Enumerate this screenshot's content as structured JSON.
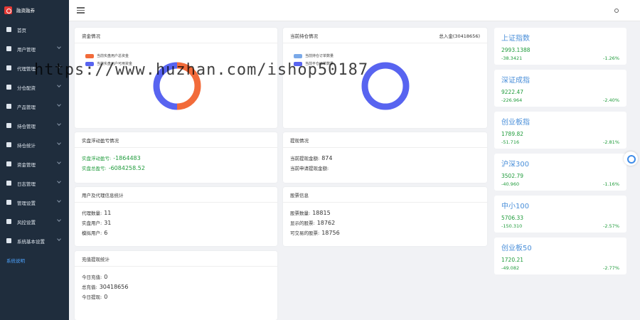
{
  "brand": {
    "title": "融资融券"
  },
  "sidebar": {
    "items": [
      {
        "label": "首页",
        "icon": "home-icon",
        "has_chevron": false
      },
      {
        "label": "用户管理",
        "icon": "user-icon",
        "has_chevron": true
      },
      {
        "label": "代理管理",
        "icon": "agent-icon",
        "has_chevron": true
      },
      {
        "label": "分仓配资",
        "icon": "split-icon",
        "has_chevron": true
      },
      {
        "label": "产品管理",
        "icon": "product-icon",
        "has_chevron": true
      },
      {
        "label": "持仓管理",
        "icon": "position-icon",
        "has_chevron": true
      },
      {
        "label": "持仓统计",
        "icon": "stats-icon",
        "has_chevron": true
      },
      {
        "label": "资金管理",
        "icon": "wallet-icon",
        "has_chevron": true
      },
      {
        "label": "日志管理",
        "icon": "log-icon",
        "has_chevron": true
      },
      {
        "label": "管理设置",
        "icon": "admin-icon",
        "has_chevron": true
      },
      {
        "label": "风控设置",
        "icon": "shield-icon",
        "has_chevron": true
      },
      {
        "label": "系统基本设置",
        "icon": "settings-icon",
        "has_chevron": true
      },
      {
        "label": "系统说明",
        "icon": "",
        "has_chevron": false,
        "active": true
      }
    ]
  },
  "funds": {
    "title": "资金情况",
    "legend": [
      {
        "label": "当前实盘用户总资金",
        "color": "#f26b3a"
      },
      {
        "label": "当前实盘用户可用资金",
        "color": "#5864f0"
      }
    ],
    "chart": {
      "type": "pie",
      "values": [
        50,
        50
      ],
      "colors": [
        "#f26b3a",
        "#5864f0"
      ]
    }
  },
  "positions": {
    "title": "当前持仓情况",
    "total_label": "总入金(30418656)",
    "legend": [
      {
        "label": "当前持仓订单数量",
        "color": "#7aa9e8"
      },
      {
        "label": "当前平仓订单数量",
        "color": "#5864f0"
      }
    ],
    "chart": {
      "type": "pie",
      "values": [
        0,
        100
      ],
      "colors": [
        "#7aa9e8",
        "#5864f0"
      ]
    }
  },
  "pnl": {
    "title": "实盘浮动盈亏情况",
    "rows": [
      {
        "label": "实盘浮动盈亏:",
        "value": "-1864483"
      },
      {
        "label": "实盘总盈亏:",
        "value": "-6084258.52"
      }
    ]
  },
  "withdraw": {
    "title": "提现情况",
    "rows": [
      {
        "label": "当前提现金额:",
        "value": "874"
      },
      {
        "label": "当前申请提现金额:",
        "value": ""
      }
    ]
  },
  "users": {
    "title": "用户及代理信息统计",
    "rows": [
      {
        "label": "代理数量:",
        "value": "11"
      },
      {
        "label": "实盘用户:",
        "value": "31"
      },
      {
        "label": "模拟用户:",
        "value": "6"
      }
    ]
  },
  "stocks": {
    "title": "股票信息",
    "rows": [
      {
        "label": "股票数量:",
        "value": "18815"
      },
      {
        "label": "显示的股票:",
        "value": "18762"
      },
      {
        "label": "可交易的股票:",
        "value": "18756"
      }
    ]
  },
  "recharge": {
    "title": "充值提现统计",
    "rows": [
      {
        "label": "今日充值:",
        "value": "0"
      },
      {
        "label": "总充值:",
        "value": "30418656"
      },
      {
        "label": "今日提现:",
        "value": "0"
      }
    ]
  },
  "indices": [
    {
      "name": "上证指数",
      "value": "2993.1388",
      "change": "-38.3421",
      "pct": "-1.26%"
    },
    {
      "name": "深证成指",
      "value": "9222.47",
      "change": "-226.964",
      "pct": "-2.40%"
    },
    {
      "name": "创业板指",
      "value": "1789.82",
      "change": "-51.716",
      "pct": "-2.81%"
    },
    {
      "name": "沪深300",
      "value": "3502.79",
      "change": "-40.960",
      "pct": "-1.16%"
    },
    {
      "name": "中小100",
      "value": "5706.33",
      "change": "-150.310",
      "pct": "-2.57%"
    },
    {
      "name": "创业板50",
      "value": "1720.21",
      "change": "-49.082",
      "pct": "-2.77%"
    }
  ],
  "watermark": {
    "text": "https://www.huzhan.com/ishop50187"
  },
  "colors": {
    "sidebar": "#1f2d3d",
    "accent": "#4a8fd9",
    "green": "#1f9b3b"
  }
}
